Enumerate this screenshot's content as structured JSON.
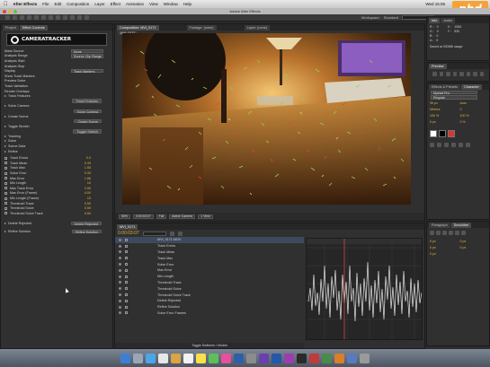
{
  "menu": {
    "app": "After Effects",
    "items": [
      "File",
      "Edit",
      "Composition",
      "Layer",
      "Effect",
      "Animation",
      "View",
      "Window",
      "Help"
    ],
    "right": [
      "Wed 15:05"
    ]
  },
  "window_title": "Adobe After Effects",
  "toolbar": {
    "workspace_label": "Workspace:",
    "workspace_value": "Standard"
  },
  "watermark": "phd",
  "effect_controls": {
    "tabs": [
      "Project",
      "Effect Controls"
    ],
    "logo_text": "CAMERATRACKER",
    "rows": [
      {
        "label": "Mask Source",
        "value": "None",
        "kind": "dd"
      },
      {
        "label": "Analysis Range",
        "value": "Source Clip Range",
        "kind": "dd"
      },
      {
        "label": "Analysis Start",
        "value": "",
        "kind": "plain"
      },
      {
        "label": "Analysis Stop",
        "value": "",
        "kind": "plain"
      },
      {
        "label": "Display",
        "value": "Track Markers",
        "kind": "dd"
      },
      {
        "label": "Show Track Markers",
        "value": "",
        "kind": "plain"
      },
      {
        "label": "Preview Solve",
        "value": "",
        "kind": "plain"
      },
      {
        "label": "Track Validation",
        "value": "",
        "kind": "plain"
      },
      {
        "label": "Render Overlays",
        "value": "",
        "kind": "plain"
      },
      {
        "label": "Track Features",
        "value": "",
        "kind": "tri"
      },
      {
        "label": "",
        "value": "Track Features",
        "kind": "btn"
      },
      {
        "label": "Solve Camera",
        "value": "",
        "kind": "tri"
      },
      {
        "label": "",
        "value": "Solve Camera",
        "kind": "btn"
      },
      {
        "label": "Create Scene",
        "value": "",
        "kind": "tri"
      },
      {
        "label": "",
        "value": "Create Scene",
        "kind": "btn"
      },
      {
        "label": "Toggle Stretch",
        "value": "",
        "kind": "tri"
      },
      {
        "label": "",
        "value": "Toggle Stretch",
        "kind": "btn"
      },
      {
        "label": "Tracking",
        "value": "",
        "kind": "tri"
      },
      {
        "label": "Solve",
        "value": "",
        "kind": "tri"
      },
      {
        "label": "Scene Data",
        "value": "",
        "kind": "tri"
      },
      {
        "label": "Refine",
        "value": "",
        "kind": "tri"
      }
    ],
    "track_rows": [
      {
        "label": "Track Errors",
        "value": "0.0"
      },
      {
        "label": "Track Mean",
        "value": "0.39"
      },
      {
        "label": "Track Max",
        "value": "1.55"
      },
      {
        "label": "Solve Error",
        "value": "0.39"
      },
      {
        "label": "Max Error",
        "value": "1.86"
      },
      {
        "label": "Min Length",
        "value": "10"
      },
      {
        "label": "Max Track Error",
        "value": "2.00"
      },
      {
        "label": "Max Error (Frame)",
        "value": "4.00"
      },
      {
        "label": "Min Length (Frame)",
        "value": "10"
      },
      {
        "label": "Threshold Track",
        "value": "0.50"
      },
      {
        "label": "Threshold Solve",
        "value": "0.50"
      },
      {
        "label": "Threshold Solve Track",
        "value": "0.50"
      }
    ],
    "footer_rows": [
      {
        "label": "Delete Rejected",
        "value": "Delete Rejected"
      },
      {
        "label": "Refine Solution",
        "value": "Refine Solution"
      }
    ]
  },
  "viewer": {
    "tabs": [
      "Composition: MVI_0171",
      "Footage: (none)",
      "Layer: (none)"
    ],
    "comp_label": "MVI_0171",
    "footer": [
      "50%",
      "0:00:03:07",
      "Full",
      "Active Camera",
      "1 View"
    ]
  },
  "info_panel": {
    "tabs": [
      "Info",
      "Audio"
    ],
    "rgb": [
      {
        "ch": "R :",
        "val": "0"
      },
      {
        "ch": "G :",
        "val": "0"
      },
      {
        "ch": "B :",
        "val": "0"
      },
      {
        "ch": "A :",
        "val": "0"
      }
    ],
    "xy": [
      {
        "ch": "X :",
        "val": "1084"
      },
      {
        "ch": "Y :",
        "val": "530"
      }
    ],
    "note": "Saved at 300MB usage"
  },
  "preview_panel": {
    "tabs": [
      "Preview"
    ]
  },
  "effects_panel": {
    "tabs": [
      "Effects & Presets",
      "Character"
    ],
    "font": "Myriad Pro",
    "style": "Regular",
    "values": [
      "36 px",
      "Auto",
      "Metrics",
      "0",
      "100 %",
      "100 %",
      "0 px",
      "0 %"
    ]
  },
  "smoother_panel": {
    "tabs": [
      "Paragraph",
      "Smoother"
    ],
    "rows": [
      "0 px",
      "0 px",
      "0 px",
      "0 px",
      "0 px"
    ]
  },
  "timeline": {
    "tabs": [
      "MVI_0171"
    ],
    "timecode": "0:00:03:07",
    "layers": [
      {
        "name": "MVI_0171.MOV",
        "sel": true
      },
      {
        "name": "Track Errors",
        "sel": false
      },
      {
        "name": "Track Mean",
        "sel": false
      },
      {
        "name": "Track Max",
        "sel": false
      },
      {
        "name": "Solve Error",
        "sel": false
      },
      {
        "name": "Max Error",
        "sel": false
      },
      {
        "name": "Min Length",
        "sel": false
      },
      {
        "name": "Threshold Track",
        "sel": false
      },
      {
        "name": "Threshold Solve",
        "sel": false
      },
      {
        "name": "Threshold Solve Track",
        "sel": false
      },
      {
        "name": "Delete Rejected",
        "sel": false
      },
      {
        "name": "Refine Solution",
        "sel": false
      },
      {
        "name": "Solve Error Frames",
        "sel": false
      }
    ],
    "footer": "Toggle Switches / Modes"
  },
  "colors": {
    "accent": "#e8b13a",
    "track_green": "#8fd14f",
    "track_red": "#e0463a",
    "graph_line": "#e8e8e8",
    "playhead": "#e0463a"
  }
}
